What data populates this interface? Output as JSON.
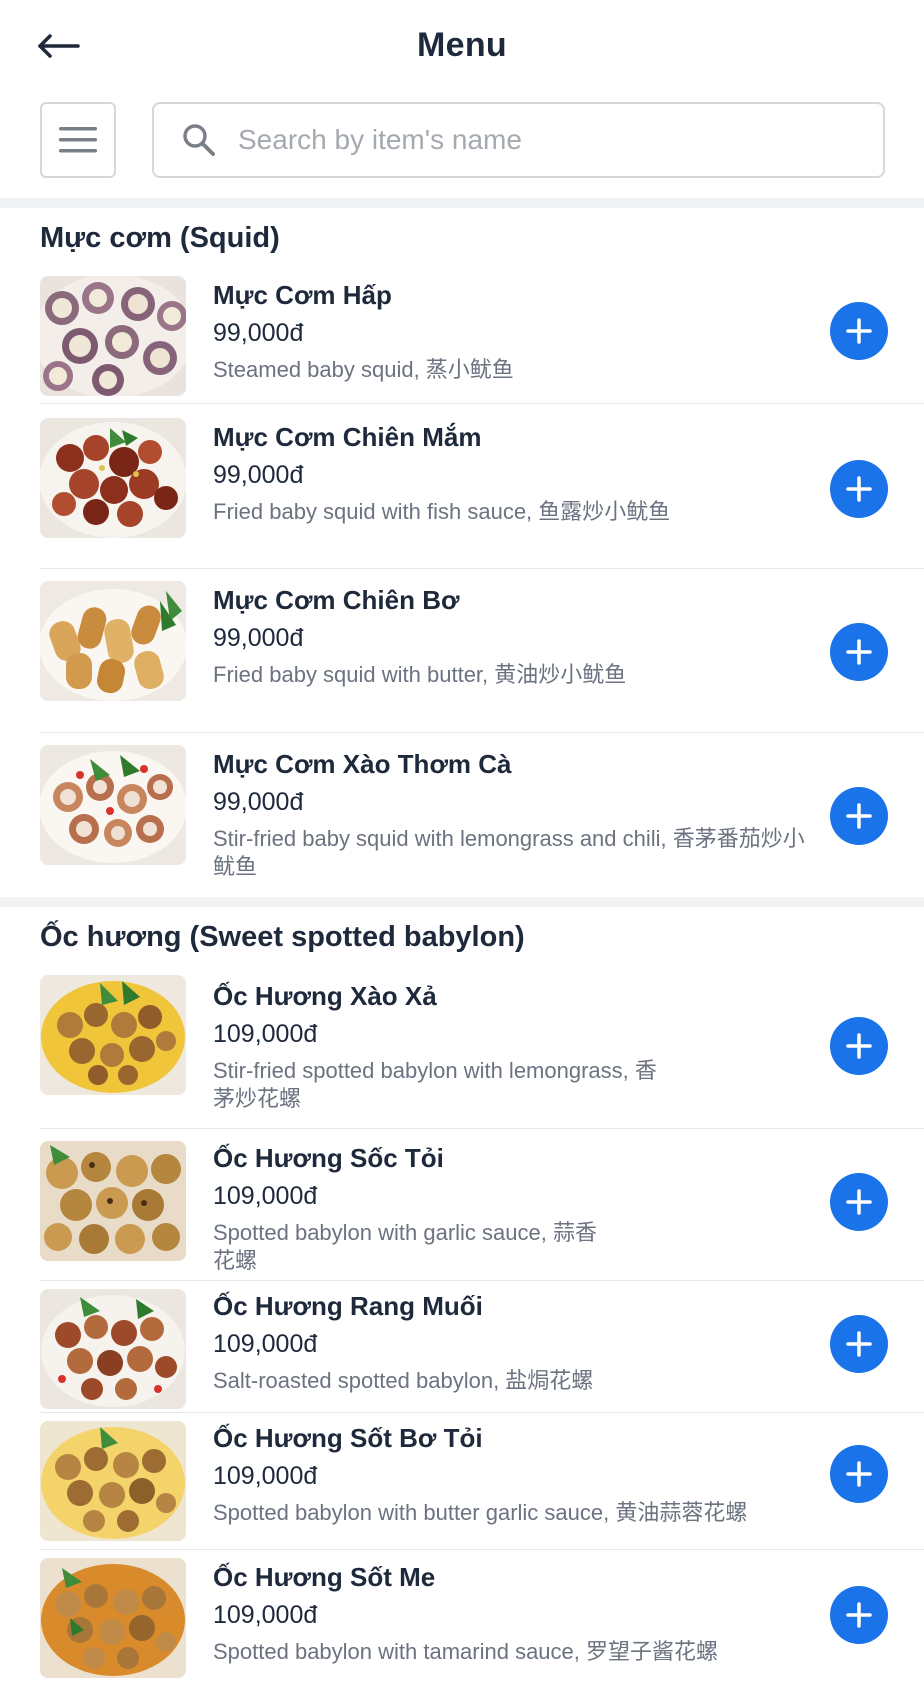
{
  "header": {
    "title": "Menu"
  },
  "search": {
    "placeholder": "Search by item's name"
  },
  "colors": {
    "accent": "#1a73e8",
    "text": "#1e293b",
    "muted": "#6b7280",
    "border": "#d4d7dc"
  },
  "categories": [
    {
      "title": "Mực cơm (Squid)",
      "items": [
        {
          "name": "Mực Cơm Hấp",
          "price": "99,000đ",
          "description": "Steamed baby squid, 蒸小鱿鱼"
        },
        {
          "name": "Mực Cơm Chiên Mắm",
          "price": "99,000đ",
          "description": "Fried baby squid with fish sauce, 鱼露炒小鱿鱼"
        },
        {
          "name": "Mực Cơm Chiên Bơ",
          "price": "99,000đ",
          "description": "Fried baby squid with butter, 黄油炒小鱿鱼"
        },
        {
          "name": "Mực Cơm Xào Thơm Cà",
          "price": "99,000đ",
          "description": "Stir-fried baby squid with lemongrass and chili, 香茅番茄炒小鱿鱼"
        }
      ]
    },
    {
      "title": "Ốc hương (Sweet spotted babylon)",
      "items": [
        {
          "name": "Ốc Hương Xào Xả",
          "price": "109,000đ",
          "description": "Stir-fried spotted babylon with lemongrass, 香茅炒花螺"
        },
        {
          "name": "Ốc Hương Sốc Tỏi",
          "price": "109,000đ",
          "description": "Spotted babylon with garlic sauce, 蒜香花螺"
        },
        {
          "name": "Ốc Hương Rang Muối",
          "price": "109,000đ",
          "description": "Salt-roasted spotted babylon, 盐焗花螺"
        },
        {
          "name": "Ốc Hương Sốt Bơ Tỏi",
          "price": "109,000đ",
          "description": "Spotted babylon with butter garlic sauce, 黄油蒜蓉花螺"
        },
        {
          "name": "Ốc Hương Sốt Me",
          "price": "109,000đ",
          "description": "Spotted babylon with tamarind sauce, 罗望子酱花螺"
        }
      ]
    }
  ]
}
